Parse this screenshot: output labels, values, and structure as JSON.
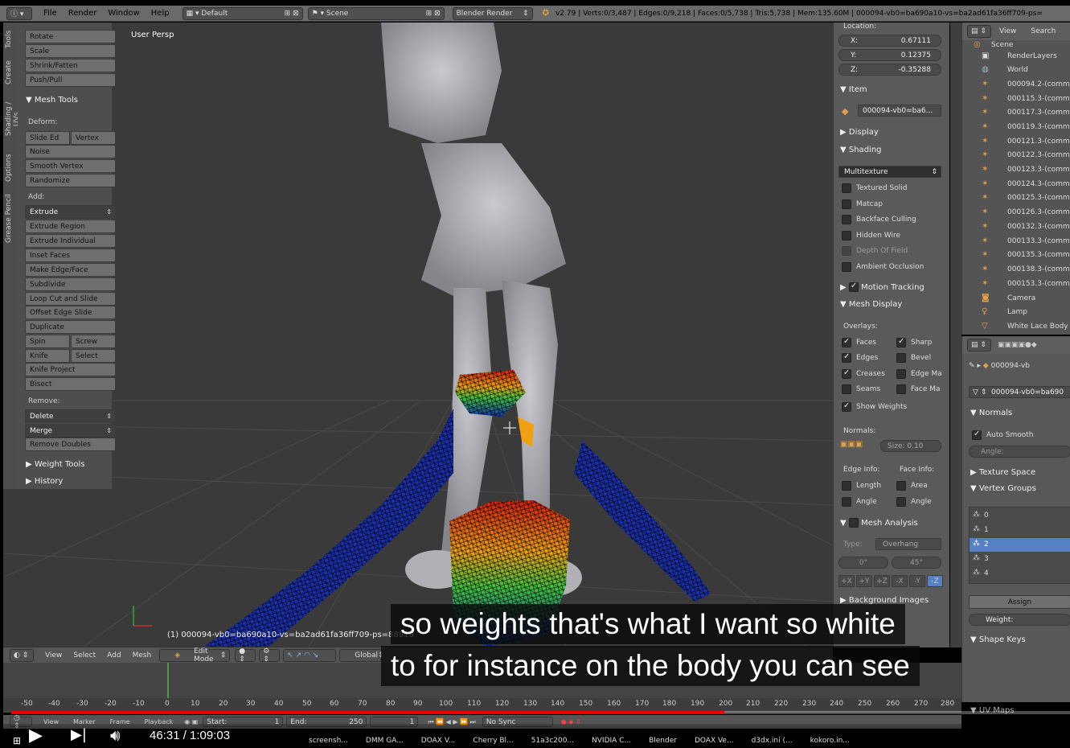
{
  "topbar": {
    "menus": [
      "File",
      "Render",
      "Window",
      "Help"
    ],
    "layout": "Default",
    "scene": "Scene",
    "engine": "Blender Render",
    "stats": "v2.79 | Verts:0/3,487 | Edges:0/9,218 | Faces:0/5,738 | Tris:5,738 | Mem:135.60M | 000094-vb0=ba690a10-vs=ba2ad61fa36ff709-ps="
  },
  "viewport": {
    "label": "User Persp",
    "object_info": "(1) 000094-vb0=ba690a10-vs=ba2ad61fa36ff709-ps=88919"
  },
  "toolshelf": {
    "tabs": [
      "Tools",
      "Create",
      "Shading / UVs",
      "Options",
      "Grease Pencil"
    ],
    "top_buttons": [
      "Rotate",
      "Scale",
      "Shrink/Fatten",
      "Push/Pull"
    ],
    "mesh_tools": "Mesh Tools",
    "deform_label": "Deform:",
    "slide_edge": "Slide Ed",
    "vertex": "Vertex",
    "deform_buttons": [
      "Noise",
      "Smooth Vertex",
      "Randomize"
    ],
    "add_label": "Add:",
    "extrude": "Extrude",
    "add_buttons": [
      "Extrude Region",
      "Extrude Individual",
      "Inset Faces",
      "Make Edge/Face",
      "Subdivide",
      "Loop Cut and Slide",
      "Offset Edge Slide",
      "Duplicate"
    ],
    "spin": "Spin",
    "screw": "Screw",
    "knife": "Knife",
    "select": "Select",
    "knife_project": "Knife Project",
    "bisect": "Bisect",
    "remove_label": "Remove:",
    "delete": "Delete",
    "merge": "Merge",
    "remove_doubles": "Remove Doubles",
    "weight_tools": "Weight Tools",
    "history": "History"
  },
  "npanel": {
    "location": "Location:",
    "x_label": "X:",
    "x_val": "0.67111",
    "y_label": "Y:",
    "y_val": "0.12375",
    "z_label": "Z:",
    "z_val": "-0.35288",
    "item": "Item",
    "item_name": "000094-vb0=ba6...",
    "display": "Display",
    "shading": "Shading",
    "shading_mode": "Multitexture",
    "shading_opts": [
      "Textured Solid",
      "Matcap",
      "Backface Culling",
      "Hidden Wire",
      "Depth Of Field",
      "Ambient Occlusion"
    ],
    "motion_tracking": "Motion Tracking",
    "mesh_display": "Mesh Display",
    "overlays": "Overlays:",
    "faces": "Faces",
    "sharp": "Sharp",
    "edges": "Edges",
    "bevel": "Bevel",
    "creases": "Creases",
    "edge_ma": "Edge Ma",
    "seams": "Seams",
    "face_ma": "Face Ma",
    "show_weights": "Show Weights",
    "normals": "Normals:",
    "size": "Size:  0.10",
    "edge_info": "Edge Info:",
    "face_info": "Face Info:",
    "length": "Length",
    "area": "Area",
    "angle1": "Angle",
    "angle2": "Angle",
    "mesh_analysis": "Mesh Analysis",
    "type_label": "Type:",
    "type_val": "Overhang",
    "deg0": "0°",
    "deg45": "45°",
    "axes": [
      "+X",
      "+Y",
      "+Z",
      "-X",
      "-Y",
      "-Z"
    ],
    "background_images": "Background Images"
  },
  "outliner": {
    "view": "View",
    "search": "Search",
    "scene": "Scene",
    "rows": [
      "RenderLayers",
      "World",
      "000094.2-(comm",
      "000115.3-(comm",
      "000117.3-(comm",
      "000119.3-(comm",
      "000121.3-(comm",
      "000122.3-(comm",
      "000123.3-(comm",
      "000124.3-(comm",
      "000125.3-(comm",
      "000126.3-(comm",
      "000132.3-(comm",
      "000133.3-(comm",
      "000135.3-(comm",
      "000138.3-(comm",
      "000153.3-(comm",
      "Camera",
      "Lamp",
      "White Lace Body"
    ]
  },
  "props": {
    "obj": "000094-vb",
    "mesh": "000094-vb0=ba690",
    "normals": "Normals",
    "auto_smooth": "Auto Smooth",
    "angle": "Angle:",
    "texture_space": "Texture Space",
    "vertex_groups": "Vertex Groups",
    "groups": [
      "0",
      "1",
      "2",
      "3",
      "4"
    ],
    "assign": "Assign",
    "weight": "Weight:",
    "shape_keys": "Shape Keys",
    "uv_maps": "UV Maps"
  },
  "vheader": {
    "items": [
      "View",
      "Select",
      "Add",
      "Mesh"
    ],
    "mode": "Edit Mode",
    "orientation": "Global"
  },
  "timeline": {
    "ticks": [
      "-50",
      "-40",
      "-30",
      "-20",
      "-10",
      "0",
      "10",
      "20",
      "30",
      "40",
      "50",
      "60",
      "70",
      "80",
      "90",
      "100",
      "110",
      "120",
      "130",
      "140",
      "150",
      "160",
      "170",
      "180",
      "190",
      "200",
      "210",
      "220",
      "230",
      "240",
      "250",
      "260",
      "270",
      "280"
    ],
    "menus": [
      "View",
      "Marker",
      "Frame",
      "Playback"
    ],
    "start": "Start:",
    "start_val": "1",
    "end": "End:",
    "end_val": "250",
    "current": "1",
    "sync": "No Sync"
  },
  "player": {
    "time": "46:31 / 1:09:03",
    "progress": 0.6737
  },
  "taskbar": {
    "items": [
      "screensh...",
      "DMM GA...",
      "DOAX V...",
      "Cherry Bl...",
      "51a3c200...",
      "NVIDIA C...",
      "Blender",
      "DOAX Ve...",
      "d3dx.ini (...",
      "kokoro.in..."
    ]
  },
  "captions": {
    "line1": "so weights that's what I want so white",
    "line2": "to for instance on the body you can see"
  }
}
